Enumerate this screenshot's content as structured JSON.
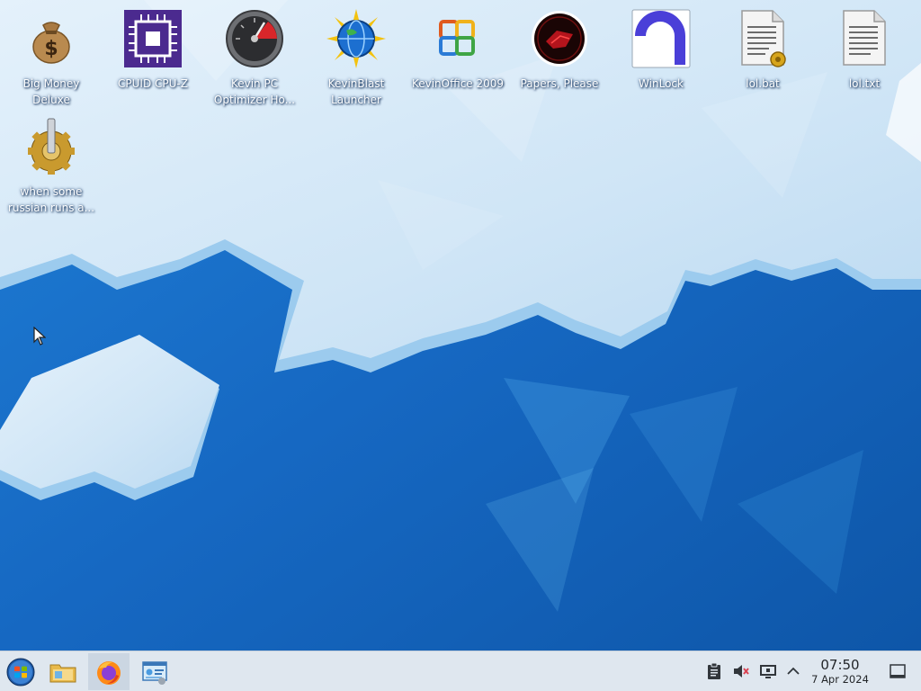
{
  "desktop": {
    "icons": [
      {
        "label": "Big Money Deluxe",
        "icon": "money-bag-icon"
      },
      {
        "label": "CPUID CPU-Z",
        "icon": "cpu-chip-icon"
      },
      {
        "label": "Kevin PC Optimizer Ho...",
        "icon": "speedometer-icon"
      },
      {
        "label": "KevinBlast Launcher",
        "icon": "globe-sun-icon"
      },
      {
        "label": "KevinOffice 2009",
        "icon": "office-logo-icon"
      },
      {
        "label": "Papers, Please",
        "icon": "papers-please-seal-icon"
      },
      {
        "label": "WinLock",
        "icon": "winlock-icon"
      },
      {
        "label": "lol.bat",
        "icon": "batch-file-icon"
      },
      {
        "label": "lol.txt",
        "icon": "text-file-icon"
      },
      {
        "label": "when some russian runs a...",
        "icon": "gear-executable-icon"
      }
    ]
  },
  "taskbar": {
    "start": {
      "icon": "start-orb-icon"
    },
    "apps": [
      {
        "icon": "file-manager-icon"
      },
      {
        "icon": "firefox-icon",
        "active": true
      },
      {
        "icon": "control-panel-icon"
      }
    ],
    "tray": [
      {
        "icon": "clipboard-icon"
      },
      {
        "icon": "volume-muted-icon"
      },
      {
        "icon": "display-icon"
      },
      {
        "icon": "chevron-up-icon"
      }
    ],
    "clock": {
      "time": "07:50",
      "date": "7 Apr 2024"
    },
    "show_desktop": {
      "icon": "show-desktop-icon"
    }
  },
  "colors": {
    "taskbar_bg": "#dfe7ef",
    "wallpaper_blue": "#1a6fc8",
    "ice": "#dcecf8"
  }
}
